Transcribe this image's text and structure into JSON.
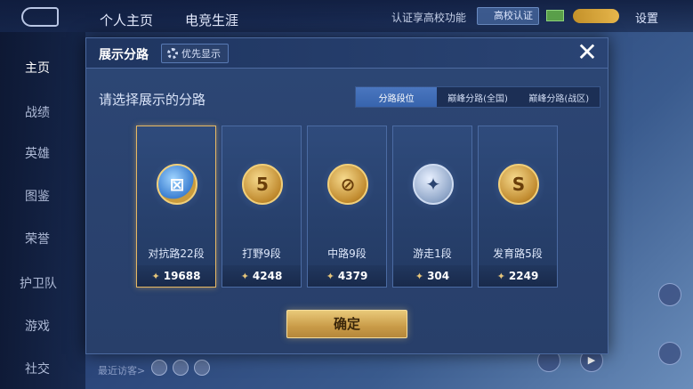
{
  "background": {
    "top_tabs": [
      "个人主页",
      "电竞生涯"
    ],
    "verify_text": "认证享高校功能",
    "campus_button": "高校认证",
    "settings": "设置",
    "nav": [
      "主页",
      "战绩",
      "英雄",
      "图鉴",
      "荣誉",
      "护卫队",
      "游戏",
      "社交"
    ],
    "visitor_text": "最近访客>"
  },
  "modal": {
    "title": "展示分路",
    "priority_button": "优先显示",
    "close_label": "✕",
    "prompt": "请选择展示的分路",
    "tabs": [
      "分路段位",
      "巅峰分路(全国)",
      "巅峰分路(战区)"
    ],
    "active_tab": 0,
    "cards": [
      {
        "label": "对抗路22段",
        "value": "19688",
        "selected": true,
        "glyph": "⊠"
      },
      {
        "label": "打野9段",
        "value": "4248",
        "selected": false,
        "glyph": "5"
      },
      {
        "label": "中路9段",
        "value": "4379",
        "selected": false,
        "glyph": "⊘"
      },
      {
        "label": "游走1段",
        "value": "304",
        "selected": false,
        "glyph": "✦"
      },
      {
        "label": "发育路5段",
        "value": "2249",
        "selected": false,
        "glyph": "S"
      }
    ],
    "confirm_button": "确定"
  },
  "colors": {
    "accent_gold": "#e6b864",
    "tab_active": "#4a76bf"
  }
}
